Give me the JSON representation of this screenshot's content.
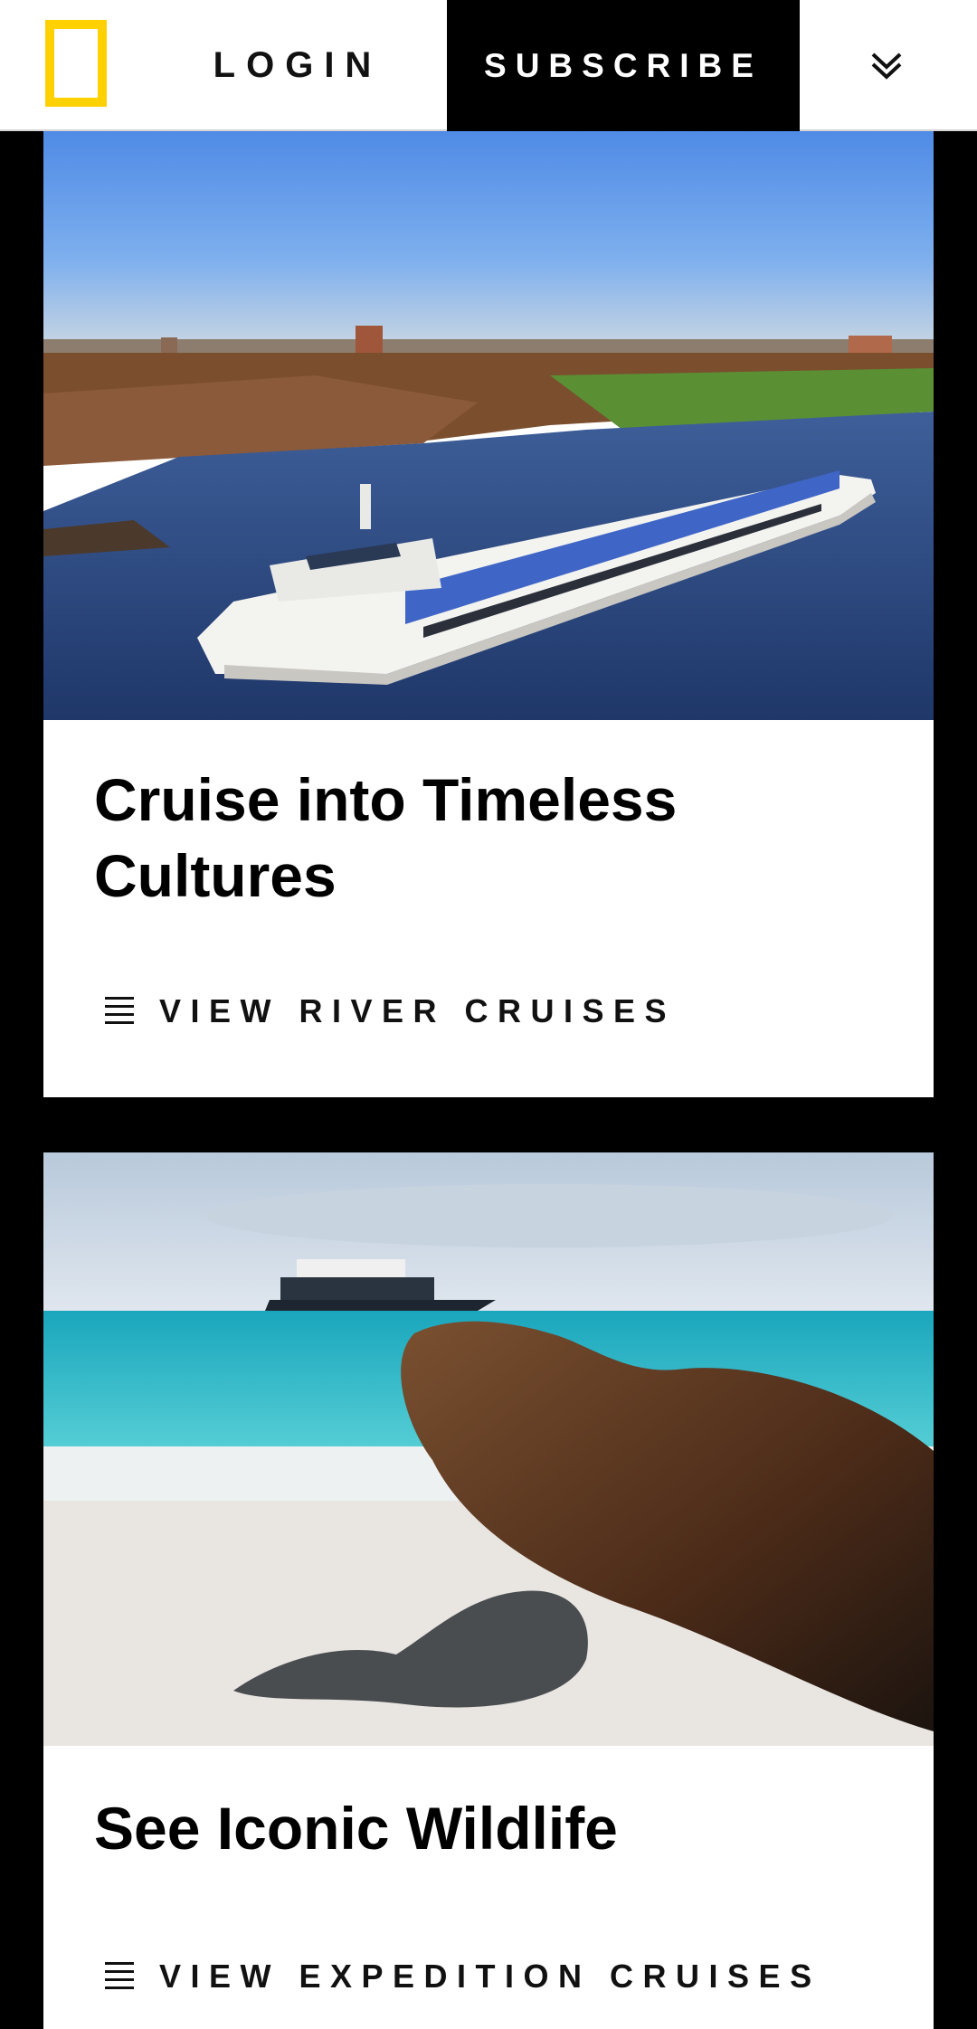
{
  "header": {
    "logo_icon": "yellow-border-logo-icon",
    "login_label": "LOGIN",
    "subscribe_label": "SUBSCRIBE",
    "menu_icon": "double-chevron-down-icon"
  },
  "cards": [
    {
      "image": "river cruise ship on a river",
      "title": "Cruise into Timeless Cultures",
      "cta_icon": "list-lines-icon",
      "cta_label": "VIEW RIVER CRUISES"
    },
    {
      "image": "sea lions on a beach with an expedition ship",
      "title": "See Iconic Wildlife",
      "cta_icon": "list-lines-icon",
      "cta_label": "VIEW EXPEDITION CRUISES"
    }
  ],
  "colors": {
    "logo_yellow": "#ffd100",
    "subscribe_bg": "#000000",
    "page_bg": "#000000"
  }
}
